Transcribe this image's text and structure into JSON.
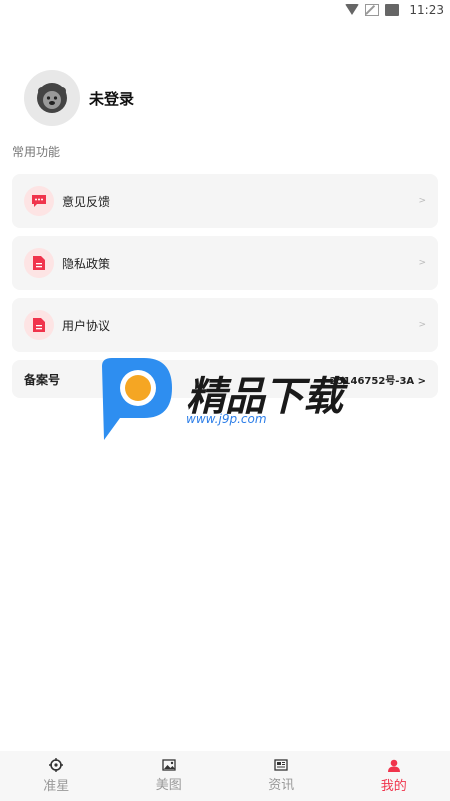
{
  "status_bar": {
    "time": "11:23"
  },
  "profile": {
    "login_text": "未登录"
  },
  "section_title": "常用功能",
  "menu": [
    {
      "label": "意见反馈",
      "icon": "message-icon",
      "chevron": ">"
    },
    {
      "label": "隐私政策",
      "icon": "document-icon",
      "chevron": ">"
    },
    {
      "label": "用户协议",
      "icon": "document-icon",
      "chevron": ">"
    }
  ],
  "record": {
    "label": "备案号",
    "value": "25146752号-3A >"
  },
  "watermark": {
    "title": "精品下载",
    "url": "www.j9p.com"
  },
  "tabs": [
    {
      "label": "准星",
      "icon": "crosshair-icon",
      "active": false
    },
    {
      "label": "美图",
      "icon": "image-icon",
      "active": false
    },
    {
      "label": "资讯",
      "icon": "news-icon",
      "active": false
    },
    {
      "label": "我的",
      "icon": "user-icon",
      "active": true
    }
  ],
  "colors": {
    "accent": "#f0344c",
    "icon_bg": "#fde4e4",
    "card_bg": "#f5f5f5"
  }
}
